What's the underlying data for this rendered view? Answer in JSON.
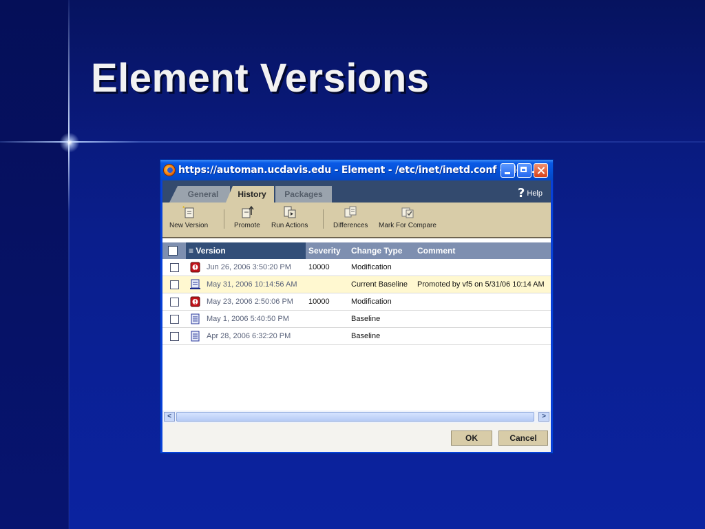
{
  "slide": {
    "title": "Element Versions"
  },
  "window": {
    "title": "https://automan.ucdavis.edu - Element - /etc/inet/inetd.conf - Mozi..."
  },
  "tabs": [
    "General",
    "History",
    "Packages"
  ],
  "active_tab": "History",
  "help_label": "Help",
  "toolbar": {
    "new_version": "New Version",
    "promote": "Promote",
    "run_actions": "Run Actions",
    "differences": "Differences",
    "mark_for_compare": "Mark For Compare"
  },
  "table": {
    "columns": [
      "Version",
      "Severity",
      "Change Type",
      "Comment"
    ],
    "rows": [
      {
        "version": "Jun 26, 2006 3:50:20 PM",
        "severity": "10000",
        "change_type": "Modification",
        "comment": "",
        "icon": "modified-doc-icon"
      },
      {
        "version": "May 31, 2006 10:14:56 AM",
        "severity": "",
        "change_type": "Current Baseline",
        "comment": "Promoted by vf5 on 5/31/06 10:14 AM",
        "icon": "baseline-doc-icon"
      },
      {
        "version": "May 23, 2006 2:50:06 PM",
        "severity": "10000",
        "change_type": "Modification",
        "comment": "",
        "icon": "modified-doc-icon"
      },
      {
        "version": "May 1, 2006 5:40:50 PM",
        "severity": "",
        "change_type": "Baseline",
        "comment": "",
        "icon": "baseline-doc-icon"
      },
      {
        "version": "Apr 28, 2006 6:32:20 PM",
        "severity": "",
        "change_type": "Baseline",
        "comment": "",
        "icon": "baseline-doc-icon"
      }
    ]
  },
  "buttons": {
    "ok": "OK",
    "cancel": "Cancel"
  },
  "colors": {
    "header_bg": "#334a6e",
    "toolbar_bg": "#d8cca8",
    "highlight_row": "#fff8d0",
    "titlebar": "#0450d6"
  }
}
